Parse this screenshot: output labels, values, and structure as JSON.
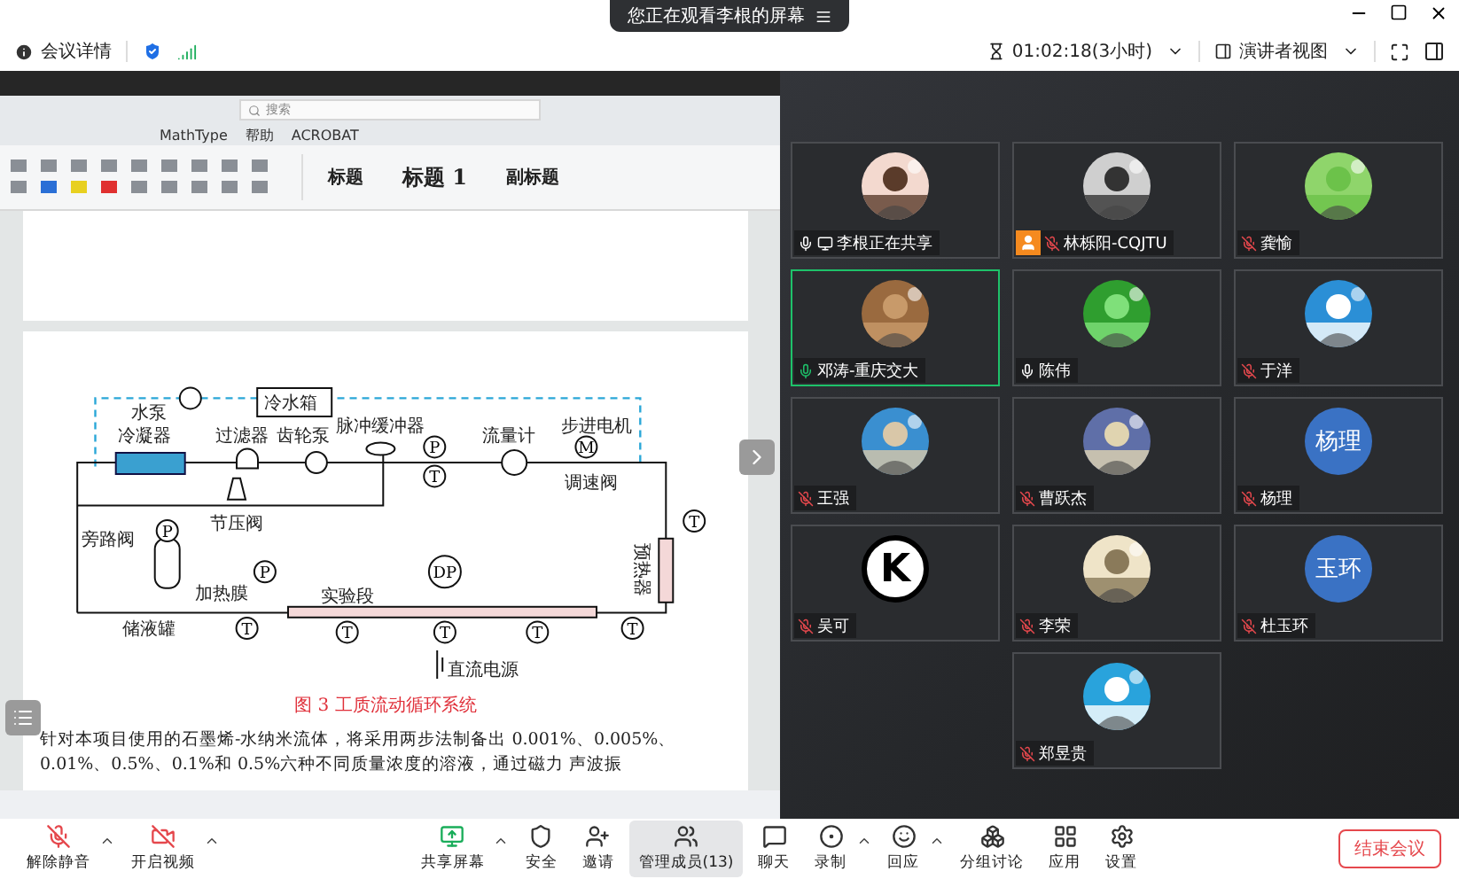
{
  "meeting_bar": {
    "share_notice": "您正在观看李根的屏幕",
    "details": "会议详情",
    "timer": "01:02:18(3小时)",
    "view": "演讲者视图"
  },
  "shared_document": {
    "search_placeholder": "搜索",
    "ribbon_tabs": [
      "MathType",
      "帮助",
      "ACROBAT"
    ],
    "styles": [
      "标题",
      "标题 1",
      "副标题"
    ],
    "diagram_labels": [
      "冷水箱",
      "水泵",
      "冷凝器",
      "过滤器",
      "齿轮泵",
      "脉冲缓冲器",
      "流量计",
      "步进电机",
      "调速阀",
      "节压阀",
      "旁路阀",
      "储液罐",
      "加热膜",
      "实验段",
      "直流电源",
      "预热器"
    ],
    "gauges": [
      "P",
      "T",
      "M",
      "T",
      "P",
      "P",
      "DP",
      "T",
      "T",
      "T",
      "T",
      "T"
    ],
    "caption": "图 3 工质流动循环系统",
    "paragraph": [
      "针对本项目使用的石墨烯-水纳米流体，将采用两步法制备出 0.001%、0.005%、",
      "0.01%、0.5%、0.1%和 0.5%六种不同质量浓度的溶液，通过磁力",
      "声波振"
    ]
  },
  "participants": [
    {
      "name": "李根正在共享",
      "muted": false,
      "sharing": true,
      "host": false,
      "speaking": false
    },
    {
      "name": "林栎阳-CQJTU",
      "muted": true,
      "sharing": false,
      "host": true,
      "speaking": false
    },
    {
      "name": "龚愉",
      "muted": true,
      "sharing": false,
      "host": false,
      "speaking": false
    },
    {
      "name": "邓涛-重庆交大",
      "muted": false,
      "sharing": false,
      "host": false,
      "speaking": true
    },
    {
      "name": "陈伟",
      "muted": false,
      "sharing": false,
      "host": false,
      "speaking": false
    },
    {
      "name": "于洋",
      "muted": true,
      "sharing": false,
      "host": false,
      "speaking": false
    },
    {
      "name": "王强",
      "muted": true,
      "sharing": false,
      "host": false,
      "speaking": false
    },
    {
      "name": "曹跃杰",
      "muted": true,
      "sharing": false,
      "host": false,
      "speaking": false
    },
    {
      "name": "杨理",
      "muted": true,
      "sharing": false,
      "host": false,
      "speaking": false,
      "avatar": {
        "kind": "text",
        "text": "杨理"
      }
    },
    {
      "name": "吴可",
      "muted": true,
      "sharing": false,
      "host": false,
      "speaking": false,
      "avatar": {
        "kind": "letter",
        "text": "K"
      }
    },
    {
      "name": "李荣",
      "muted": true,
      "sharing": false,
      "host": false,
      "speaking": false
    },
    {
      "name": "杜玉环",
      "muted": true,
      "sharing": false,
      "host": false,
      "speaking": false,
      "avatar": {
        "kind": "text",
        "text": "玉环"
      }
    },
    {
      "name": "郑昱贵",
      "muted": true,
      "sharing": false,
      "host": false,
      "speaking": false
    }
  ],
  "toolbar": [
    {
      "kind": "mic-off",
      "label": "解除静音",
      "menu": true,
      "selected": false
    },
    {
      "kind": "video-off",
      "label": "开启视频",
      "menu": true,
      "selected": false
    },
    {
      "kind": "share",
      "label": "共享屏幕",
      "menu": true,
      "selected": false
    },
    {
      "kind": "security",
      "label": "安全",
      "menu": false,
      "selected": false
    },
    {
      "kind": "invite",
      "label": "邀请",
      "menu": false,
      "selected": false
    },
    {
      "kind": "members",
      "label": "管理成员(13)",
      "menu": false,
      "selected": true
    },
    {
      "kind": "chat",
      "label": "聊天",
      "menu": false,
      "selected": false
    },
    {
      "kind": "record",
      "label": "录制",
      "menu": true,
      "selected": false
    },
    {
      "kind": "react",
      "label": "回应",
      "menu": true,
      "selected": false
    },
    {
      "kind": "breakout",
      "label": "分组讨论",
      "menu": false,
      "selected": false
    },
    {
      "kind": "apps",
      "label": "应用",
      "menu": false,
      "selected": false
    },
    {
      "kind": "settings",
      "label": "设置",
      "menu": false,
      "selected": false
    }
  ],
  "end_button": "结束会议"
}
